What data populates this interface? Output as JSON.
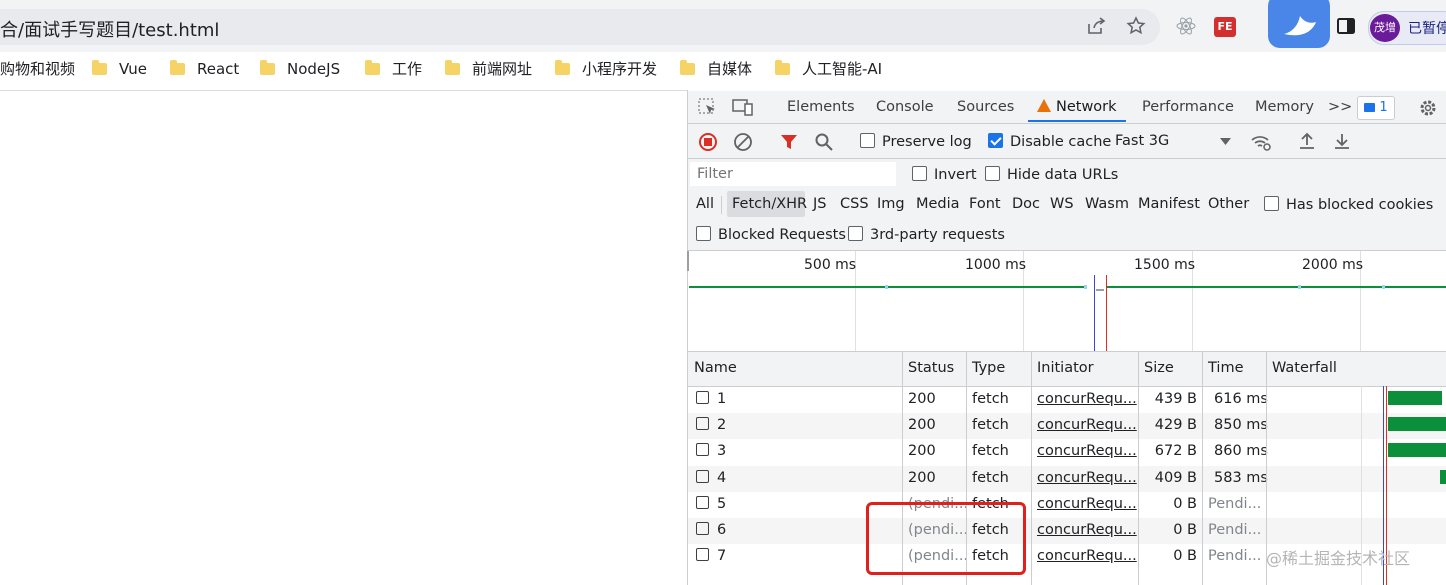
{
  "browser": {
    "url": "合/面试手写题目/test.html",
    "profile_name": "茂增",
    "profile_status": "已暂停",
    "bookmarks": [
      "购物和视频",
      "Vue",
      "React",
      "NodeJS",
      "工作",
      "前端网址",
      "小程序开发",
      "自媒体",
      "人工智能-AI"
    ]
  },
  "devtools": {
    "tabs": [
      "Elements",
      "Console",
      "Sources",
      "Network",
      "Performance",
      "Memory"
    ],
    "active_tab": "Network",
    "more_tabs": ">>",
    "message_count": "1",
    "toolbar": {
      "preserve_log": "Preserve log",
      "disable_cache": "Disable cache",
      "throttle": "Fast 3G"
    },
    "filter": {
      "placeholder": "Filter",
      "invert": "Invert",
      "hide_data_urls": "Hide data URLs",
      "types": [
        "All",
        "Fetch/XHR",
        "JS",
        "CSS",
        "Img",
        "Media",
        "Font",
        "Doc",
        "WS",
        "Wasm",
        "Manifest",
        "Other"
      ],
      "selected_type": "Fetch/XHR",
      "has_blocked_cookies": "Has blocked cookies",
      "blocked_requests": "Blocked Requests",
      "third_party": "3rd-party requests"
    },
    "overview_ticks": [
      "500 ms",
      "1000 ms",
      "1500 ms",
      "2000 ms"
    ],
    "table": {
      "columns": [
        "Name",
        "Status",
        "Type",
        "Initiator",
        "Size",
        "Time",
        "Waterfall"
      ],
      "rows": [
        {
          "name": "1",
          "status": "200",
          "type": "fetch",
          "initiator": "concurRequ...",
          "size": "439 B",
          "time": "616 ms"
        },
        {
          "name": "2",
          "status": "200",
          "type": "fetch",
          "initiator": "concurRequ...",
          "size": "429 B",
          "time": "850 ms"
        },
        {
          "name": "3",
          "status": "200",
          "type": "fetch",
          "initiator": "concurRequ...",
          "size": "672 B",
          "time": "860 ms"
        },
        {
          "name": "4",
          "status": "200",
          "type": "fetch",
          "initiator": "concurRequ...",
          "size": "409 B",
          "time": "583 ms"
        },
        {
          "name": "5",
          "status": "(pendi...",
          "type": "fetch",
          "initiator": "concurRequ...",
          "size": "0 B",
          "time": "Pendi..."
        },
        {
          "name": "6",
          "status": "(pendi...",
          "type": "fetch",
          "initiator": "concurRequ...",
          "size": "0 B",
          "time": "Pendi..."
        },
        {
          "name": "7",
          "status": "(pendi...",
          "type": "fetch",
          "initiator": "concurRequ...",
          "size": "0 B",
          "time": "Pendi..."
        }
      ]
    }
  },
  "watermark": "@稀土掘金技术社区",
  "colors": {
    "accent": "#1a73e8",
    "warning": "#e8710a",
    "waterfall": "#0b8f3a",
    "highlight": "#e0201c"
  }
}
